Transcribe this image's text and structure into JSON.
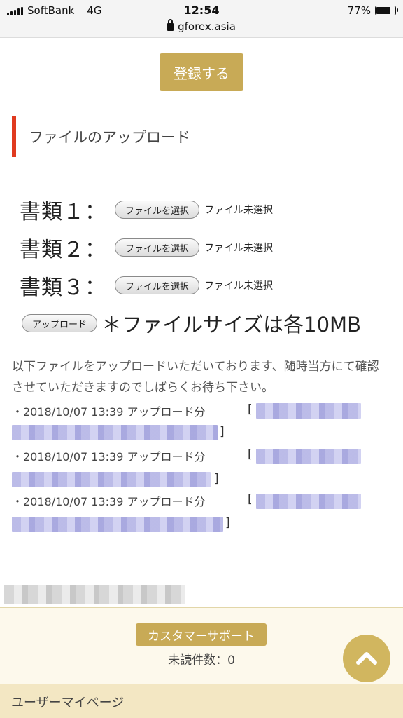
{
  "status_bar": {
    "carrier": "SoftBank",
    "network": "4G",
    "time": "12:54",
    "url": "gforex.asia",
    "battery": "77%",
    "battery_level": 0.77
  },
  "register_button": "登録する",
  "section_title": "ファイルのアップロード",
  "documents": [
    {
      "label": "書類１：",
      "button": "ファイルを選択",
      "status": "ファイル未選択"
    },
    {
      "label": "書類２：",
      "button": "ファイルを選択",
      "status": "ファイル未選択"
    },
    {
      "label": "書類３：",
      "button": "ファイルを選択",
      "status": "ファイル未選択"
    }
  ],
  "upload_button": "アップロード",
  "size_note": "＊ファイルサイズは各10MB",
  "notice": "以下ファイルをアップロードいただいております、随時当方にて確認させていただきますのでしばらくお待ち下さい。",
  "uploads": [
    {
      "text": "・2018/10/07 13:39 アップロード分",
      "open": "[",
      "close": "]"
    },
    {
      "text": "・2018/10/07 13:39 アップロード分",
      "open": "[",
      "close": "]"
    },
    {
      "text": "・2018/10/07 13:39 アップロード分",
      "open": "[",
      "close": "]"
    }
  ],
  "footer": {
    "support_button": "カスタマーサポート",
    "unread": "未読件数：0",
    "mypage": "ユーザーマイページ"
  },
  "colors": {
    "gold": "#c8aa56",
    "accent_red": "#e03a1f"
  }
}
